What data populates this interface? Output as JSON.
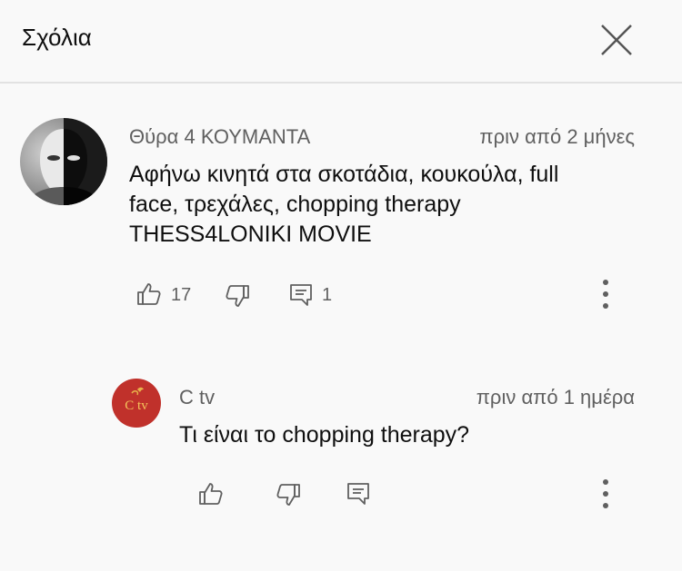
{
  "header": {
    "title": "Σχόλια"
  },
  "comment": {
    "author": "Θύρα 4 ΚΟΥΜΑΝΤΑ",
    "time": "πριν από 2 μήνες",
    "text_lines": [
      "Αφήνω κινητά στα σκοτάδια, κουκούλα, full",
      "face, τρεχάλες, chopping therapy",
      "THESS4LONIKI MOVIE"
    ],
    "likes": "17",
    "replies": "1"
  },
  "reply": {
    "author": "C tv",
    "avatar_text": "C tv",
    "time": "πριν από 1 ημέρα",
    "text": "Τι είναι το chopping therapy?"
  },
  "colors": {
    "background": "#f9f9f9",
    "secondary_text": "#606060",
    "avatar_red": "#c0312b"
  }
}
